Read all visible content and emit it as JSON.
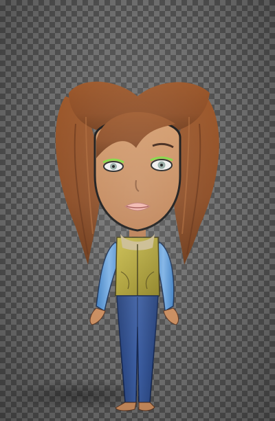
{
  "scene": {
    "subject": "avatar-doll",
    "background": "transparency-checkerboard"
  },
  "colors": {
    "hair": "#8b4a22",
    "hair_dark": "#5e2c10",
    "skin": "#c98c5e",
    "jacket_vest": "#b7a93a",
    "sleeves": "#4f8fd0",
    "jeans": "#2d4b8c",
    "checker_light": "#6e6e6e",
    "checker_dark": "#4f4f4f"
  }
}
